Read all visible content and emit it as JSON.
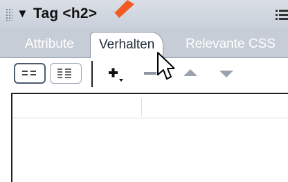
{
  "panel": {
    "title": "Tag <h2>",
    "collapse_icon": "triangle-down-icon",
    "options_icon": "panel-options-icon"
  },
  "tabs": [
    {
      "label": "Attribute",
      "active": false
    },
    {
      "label": "Verhalten",
      "active": true
    },
    {
      "label": "Relevante CSS",
      "active": false
    }
  ],
  "toolbar": {
    "buttons": [
      "category-view-icon",
      "list-view-icon",
      "add-behavior-icon",
      "remove-behavior-icon",
      "move-up-icon",
      "move-down-icon"
    ]
  },
  "colors": {
    "header_bg": "#c9d0da",
    "tab_bar_bg": "#c7cdd6",
    "annotation_arrow": "#f25c24"
  }
}
